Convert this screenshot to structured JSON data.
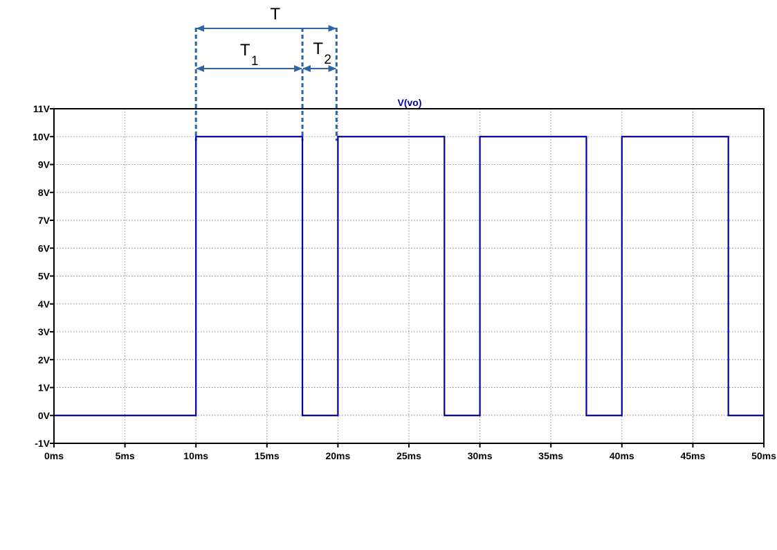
{
  "chart_data": {
    "type": "line",
    "title": "",
    "xlabel": "",
    "ylabel": "",
    "xlim": [
      0,
      50
    ],
    "ylim": [
      -1,
      11
    ],
    "grid": true,
    "x_ticks": [
      0,
      5,
      10,
      15,
      20,
      25,
      30,
      35,
      40,
      45,
      50
    ],
    "x_tick_labels": [
      "0ms",
      "5ms",
      "10ms",
      "15ms",
      "20ms",
      "25ms",
      "30ms",
      "35ms",
      "40ms",
      "45ms",
      "50ms"
    ],
    "y_ticks": [
      -1,
      0,
      1,
      2,
      3,
      4,
      5,
      6,
      7,
      8,
      9,
      10,
      11
    ],
    "y_tick_labels": [
      "-1V",
      "0V",
      "1V",
      "2V",
      "3V",
      "4V",
      "5V",
      "6V",
      "7V",
      "8V",
      "9V",
      "10V",
      "11V"
    ],
    "series": [
      {
        "name": "V(vo)",
        "color": "#0000a0",
        "x": [
          0,
          10,
          10,
          17.5,
          17.5,
          20,
          20,
          27.5,
          27.5,
          30,
          30,
          37.5,
          37.5,
          40,
          40,
          47.5,
          47.5,
          50
        ],
        "y": [
          0,
          0,
          10,
          10,
          0,
          0,
          10,
          10,
          0,
          0,
          10,
          10,
          0,
          0,
          10,
          10,
          0,
          0
        ]
      }
    ],
    "annotations": {
      "color": "#2e64a8",
      "T": {
        "label": "T",
        "sub": "",
        "from": 10,
        "to": 19.9
      },
      "T1": {
        "label": "T",
        "sub": "1",
        "from": 10,
        "to": 17.5
      },
      "T2": {
        "label": "T",
        "sub": "2",
        "from": 17.5,
        "to": 19.9
      },
      "guides": [
        10,
        17.5,
        19.9
      ]
    }
  }
}
